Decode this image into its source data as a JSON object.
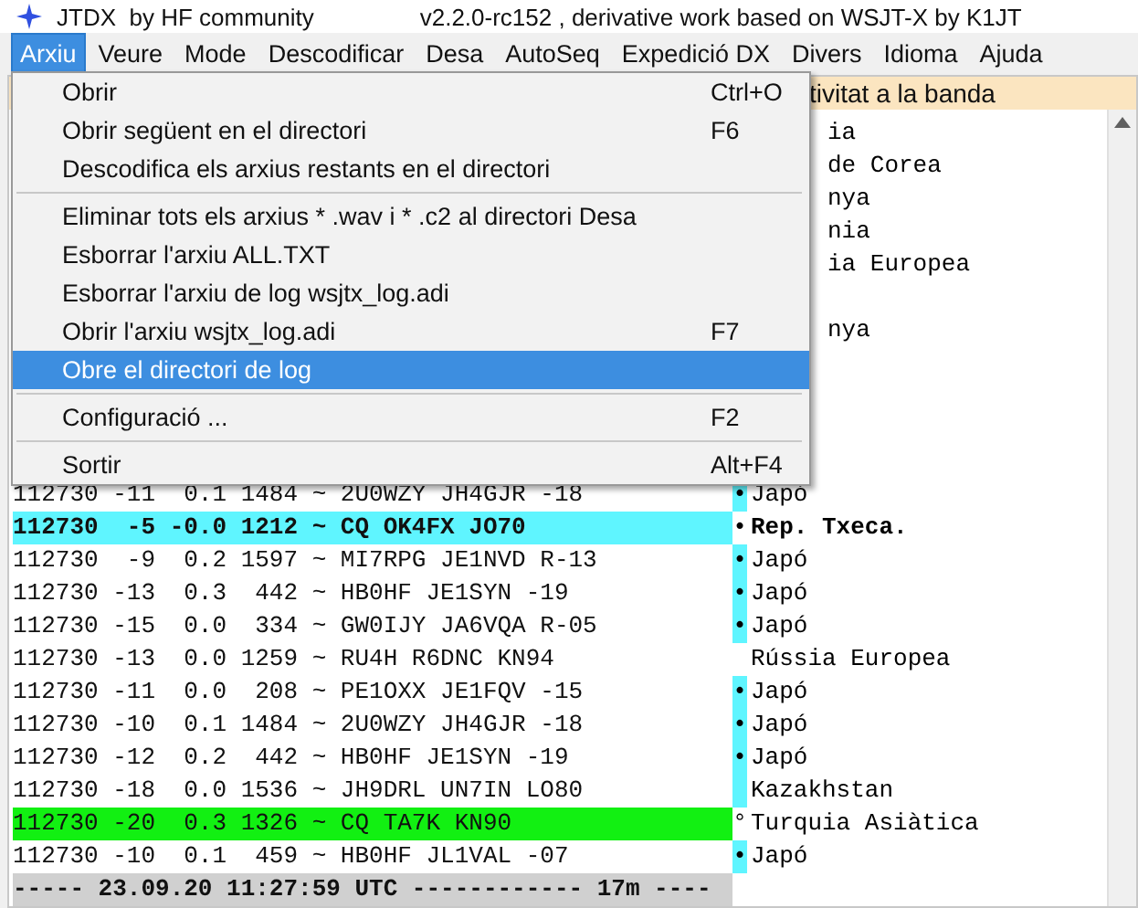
{
  "window": {
    "title": "JTDX  by HF community",
    "subtitle": "v2.2.0-rc152 , derivative work based on WSJT-X by K1JT"
  },
  "menubar": [
    {
      "label": "Arxiu",
      "selected": true
    },
    {
      "label": "Veure",
      "selected": false
    },
    {
      "label": "Mode",
      "selected": false
    },
    {
      "label": "Descodificar",
      "selected": false
    },
    {
      "label": "Desa",
      "selected": false
    },
    {
      "label": "AutoSeq",
      "selected": false
    },
    {
      "label": "Expedició DX",
      "selected": false
    },
    {
      "label": "Divers",
      "selected": false
    },
    {
      "label": "Idioma",
      "selected": false
    },
    {
      "label": "Ajuda",
      "selected": false
    }
  ],
  "menu": [
    {
      "kind": "item",
      "label": "Obrir",
      "shortcut": "Ctrl+O",
      "selected": false
    },
    {
      "kind": "item",
      "label": "Obrir següent en el directori",
      "shortcut": "F6",
      "selected": false
    },
    {
      "kind": "item",
      "label": "Descodifica els arxius restants en el directori",
      "selected": false
    },
    {
      "kind": "separator"
    },
    {
      "kind": "item",
      "label": "Eliminar tots els arxius * .wav i * .c2 al directori Desa",
      "selected": false
    },
    {
      "kind": "item",
      "label": "Esborrar l'arxiu ALL.TXT",
      "selected": false
    },
    {
      "kind": "item",
      "label": "Esborrar l'arxiu de log wsjtx_log.adi",
      "selected": false
    },
    {
      "kind": "item",
      "label": "Obrir l'arxiu wsjtx_log.adi",
      "shortcut": "F7",
      "selected": false
    },
    {
      "kind": "item",
      "label": "Obre el directori de log",
      "selected": true
    },
    {
      "kind": "separator"
    },
    {
      "kind": "item",
      "label": "Configuració ...",
      "shortcut": "F2",
      "selected": false
    },
    {
      "kind": "separator"
    },
    {
      "kind": "item",
      "label": "Sortir",
      "shortcut": "Alt+F4",
      "selected": false
    }
  ],
  "decodes": {
    "header": "tivitat a la banda",
    "rows": [
      {
        "kind": "normal",
        "country": "ia"
      },
      {
        "kind": "normal",
        "country": "de Corea"
      },
      {
        "kind": "normal",
        "country": "nya"
      },
      {
        "kind": "normal",
        "country": "nia"
      },
      {
        "kind": "normal",
        "country": "ia Europea"
      },
      {
        "kind": "normal"
      },
      {
        "kind": "normal",
        "country": "nya"
      },
      {
        "kind": "normal"
      },
      {
        "kind": "normal"
      },
      {
        "kind": "normal"
      },
      {
        "kind": "normal"
      },
      {
        "kind": "normal",
        "message": "112730 -11  0.1 1484 ~ 2U0WZY JH4GJR -18",
        "marker": "•",
        "country": "Japó",
        "flagged": true
      },
      {
        "kind": "cq_new",
        "message": "112730  -5 -0.0 1212 ~ CQ OK4FX JO70",
        "marker": "•",
        "country": "Rep. Txeca.",
        "flagged": false
      },
      {
        "kind": "normal",
        "message": "112730  -9  0.2 1597 ~ MI7RPG JE1NVD R-13",
        "marker": "•",
        "country": "Japó",
        "flagged": true
      },
      {
        "kind": "normal",
        "message": "112730 -13  0.3  442 ~ HB0HF JE1SYN -19",
        "marker": "•",
        "country": "Japó",
        "flagged": true
      },
      {
        "kind": "normal",
        "message": "112730 -15  0.0  334 ~ GW0IJY JA6VQA R-05",
        "marker": "•",
        "country": "Japó",
        "flagged": true
      },
      {
        "kind": "normal",
        "message": "112730 -13  0.0 1259 ~ RU4H R6DNC KN94",
        "country": "Rússia Europea"
      },
      {
        "kind": "normal",
        "message": "112730 -11  0.0  208 ~ PE1OXX JE1FQV -15",
        "marker": "•",
        "country": "Japó",
        "flagged": true
      },
      {
        "kind": "normal",
        "message": "112730 -10  0.1 1484 ~ 2U0WZY JH4GJR -18",
        "marker": "•",
        "country": "Japó",
        "flagged": true
      },
      {
        "kind": "normal",
        "message": "112730 -12  0.2  442 ~ HB0HF JE1SYN -19",
        "marker": "•",
        "country": "Japó",
        "flagged": true
      },
      {
        "kind": "normal",
        "message": "112730 -18  0.0 1536 ~ JH9DRL UN7IN LO80",
        "country": "Kazakhstan",
        "flagged": true
      },
      {
        "kind": "cq",
        "message": "112730 -20  0.3 1326 ~ CQ TA7K KN90",
        "marker": "°",
        "country": "Turquia Asiàtica",
        "flagged": false
      },
      {
        "kind": "normal",
        "message": "112730 -10  0.1  459 ~ HB0HF JL1VAL -07",
        "marker": "•",
        "country": "Japó",
        "flagged": true
      },
      {
        "kind": "separator",
        "message": "----- 23.09.20 11:27:59 UTC ------------ 17m ----"
      }
    ]
  }
}
